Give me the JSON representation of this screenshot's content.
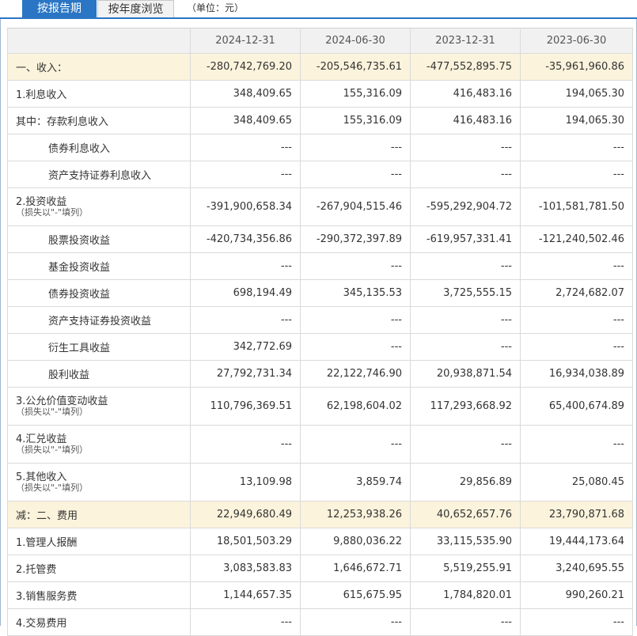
{
  "tabs": [
    {
      "label": "按报告期"
    },
    {
      "label": "按年度浏览"
    }
  ],
  "unit_label": "（单位：元）",
  "columns": [
    "2024-12-31",
    "2024-06-30",
    "2023-12-31",
    "2023-06-30"
  ],
  "rows": [
    {
      "label": "一、收入：",
      "values": [
        "-280,742,769.20",
        "-205,546,735.61",
        "-477,552,895.75",
        "-35,961,960.86"
      ]
    },
    {
      "label": "1.利息收入",
      "values": [
        "348,409.65",
        "155,316.09",
        "416,483.16",
        "194,065.30"
      ]
    },
    {
      "label": "其中：存款利息收入",
      "values": [
        "348,409.65",
        "155,316.09",
        "416,483.16",
        "194,065.30"
      ]
    },
    {
      "label": "债券利息收入",
      "values": [
        "---",
        "---",
        "---",
        "---"
      ]
    },
    {
      "label": "资产支持证券利息收入",
      "values": [
        "---",
        "---",
        "---",
        "---"
      ]
    },
    {
      "label": "2.投资收益",
      "sub": "（损失以\"-\"填列）",
      "values": [
        "-391,900,658.34",
        "-267,904,515.46",
        "-595,292,904.72",
        "-101,581,781.50"
      ]
    },
    {
      "label": "股票投资收益",
      "values": [
        "-420,734,356.86",
        "-290,372,397.89",
        "-619,957,331.41",
        "-121,240,502.46"
      ]
    },
    {
      "label": "基金投资收益",
      "values": [
        "---",
        "---",
        "---",
        "---"
      ]
    },
    {
      "label": "债券投资收益",
      "values": [
        "698,194.49",
        "345,135.53",
        "3,725,555.15",
        "2,724,682.07"
      ]
    },
    {
      "label": "资产支持证券投资收益",
      "values": [
        "---",
        "---",
        "---",
        "---"
      ]
    },
    {
      "label": "衍生工具收益",
      "values": [
        "342,772.69",
        "---",
        "---",
        "---"
      ]
    },
    {
      "label": "股利收益",
      "values": [
        "27,792,731.34",
        "22,122,746.90",
        "20,938,871.54",
        "16,934,038.89"
      ]
    },
    {
      "label": "3.公允价值变动收益",
      "sub": "（损失以\"-\"填列）",
      "values": [
        "110,796,369.51",
        "62,198,604.02",
        "117,293,668.92",
        "65,400,674.89"
      ]
    },
    {
      "label": "4.汇兑收益",
      "sub": "（损失以\"-\"填列）",
      "values": [
        "---",
        "---",
        "---",
        "---"
      ]
    },
    {
      "label": "5.其他收入",
      "sub": "（损失以\"-\"填列）",
      "values": [
        "13,109.98",
        "3,859.74",
        "29,856.89",
        "25,080.45"
      ]
    },
    {
      "label": "减：二、费用",
      "values": [
        "22,949,680.49",
        "12,253,938.26",
        "40,652,657.76",
        "23,790,871.68"
      ]
    },
    {
      "label": "1.管理人报酬",
      "values": [
        "18,501,503.29",
        "9,880,036.22",
        "33,115,535.90",
        "19,444,173.64"
      ]
    },
    {
      "label": "2.托管费",
      "values": [
        "3,083,583.83",
        "1,646,672.71",
        "5,519,255.91",
        "3,240,695.55"
      ]
    },
    {
      "label": "3.销售服务费",
      "values": [
        "1,144,657.35",
        "615,675.95",
        "1,784,820.01",
        "990,260.21"
      ]
    },
    {
      "label": "4.交易费用",
      "values": [
        "---",
        "---",
        "---",
        "---"
      ]
    }
  ]
}
